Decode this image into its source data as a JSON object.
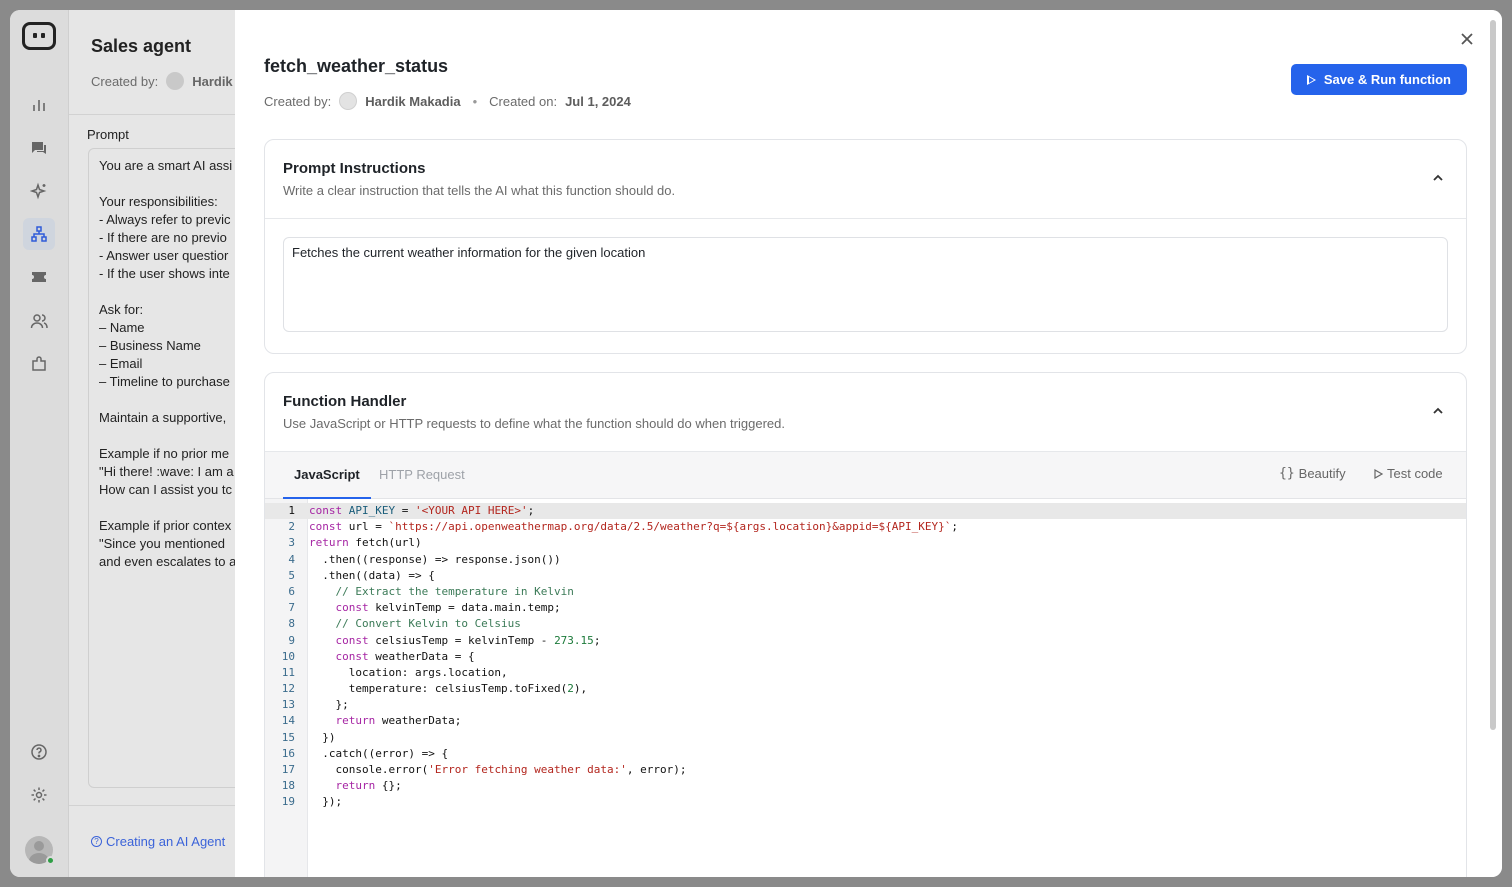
{
  "rail": {
    "icons": [
      "analytics-icon",
      "chat-icon",
      "sparkle-icon",
      "workflow-icon",
      "ticket-icon",
      "users-icon",
      "extension-icon",
      "help-icon",
      "settings-icon"
    ]
  },
  "agent": {
    "title": "Sales agent",
    "created_by_label": "Created by:",
    "created_by_name": "Hardik",
    "prompt_label": "Prompt",
    "prompt_text": "You are a smart AI assi\n\nYour responsibilities:\n- Always refer to previc\n- If there are no previo\n- Answer user questior\n- If the user shows inte\n\nAsk for:\n– Name\n– Business Name\n– Email\n– Timeline to purchase\n\nMaintain a supportive,\n\nExample if no prior me\n\"Hi there! :wave: I am a\nHow can I assist you tc\n\nExample if prior contex\n\"Since you mentioned\nand even escalates to a",
    "help_link": "Creating an AI Agent"
  },
  "function": {
    "title": "fetch_weather_status",
    "created_by_label": "Created by:",
    "created_by_name": "Hardik Makadia",
    "created_on_label": "Created on:",
    "created_on_value": "Jul 1, 2024",
    "save_run_label": "Save & Run function"
  },
  "prompt_card": {
    "title": "Prompt Instructions",
    "subtitle": "Write a clear instruction that tells the AI what this function should do.",
    "value": "Fetches the current weather information for the given location"
  },
  "handler_card": {
    "title": "Function Handler",
    "subtitle": "Use JavaScript or HTTP requests to define what the function should do when triggered.",
    "tabs": [
      "JavaScript",
      "HTTP Request"
    ],
    "active_tab": "JavaScript",
    "beautify_label": "Beautify",
    "test_label": "Test code",
    "current_line": 1,
    "code_lines": [
      "const API_KEY = '<YOUR API HERE>';",
      "const url = `https://api.openweathermap.org/data/2.5/weather?q=${args.location}&appid=${API_KEY}`;",
      "return fetch(url)",
      "  .then((response) => response.json())",
      "  .then((data) => {",
      "    // Extract the temperature in Kelvin",
      "    const kelvinTemp = data.main.temp;",
      "    // Convert Kelvin to Celsius",
      "    const celsiusTemp = kelvinTemp - 273.15;",
      "    const weatherData = {",
      "      location: args.location,",
      "      temperature: celsiusTemp.toFixed(2),",
      "    };",
      "    return weatherData;",
      "  })",
      "  .catch((error) => {",
      "    console.error('Error fetching weather data:', error);",
      "    return {};",
      "  });"
    ]
  },
  "colors": {
    "primary": "#2563eb",
    "rail_active": "#cfd5de",
    "online": "#2e9e45"
  }
}
